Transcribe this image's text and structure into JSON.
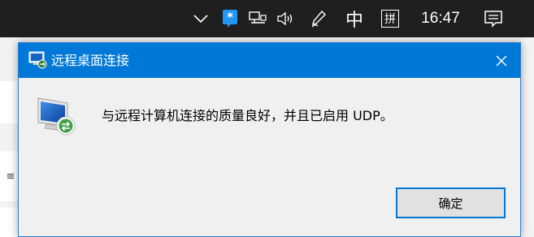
{
  "taskbar": {
    "clock": "16:47",
    "ime_language": "中",
    "ime_mode": "拼",
    "icons": [
      "chevron-up-icon",
      "app-tray-icon",
      "network-icon",
      "volume-icon",
      "pen-icon",
      "action-center-icon"
    ]
  },
  "background": {
    "side_glyph": "≡"
  },
  "dialog": {
    "title": "远程桌面连接",
    "message": "与远程计算机连接的质量良好，并且已启用 UDP。",
    "ok_label": "确定"
  },
  "colors": {
    "titlebar": "#0078d7",
    "taskbar": "#1f1f1f",
    "dialog_bg": "#f0f0f0",
    "button_border": "#0078d7"
  }
}
